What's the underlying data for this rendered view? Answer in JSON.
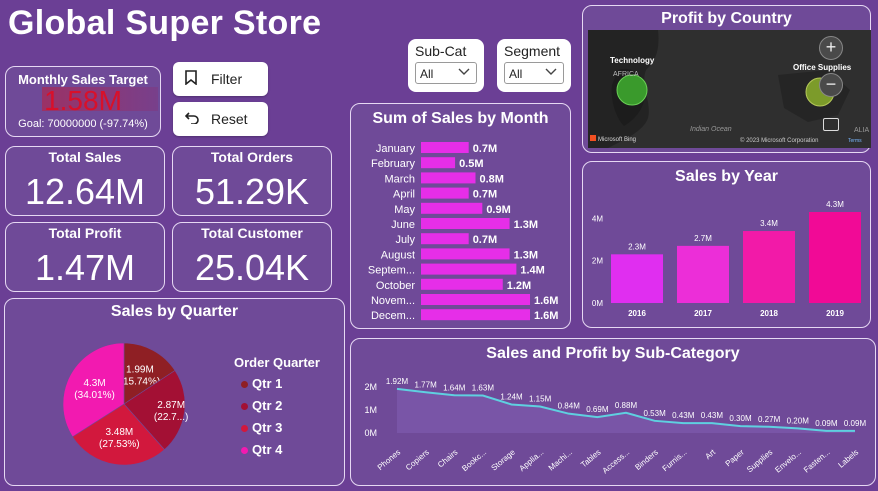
{
  "app": {
    "title": "Global Super Store"
  },
  "controls": {
    "filter_label": "Filter",
    "reset_label": "Reset",
    "subcat": {
      "label": "Sub-Cat",
      "value": "All"
    },
    "segment": {
      "label": "Segment",
      "value": "All"
    }
  },
  "target_card": {
    "title": "Monthly Sales Target",
    "value": "1.58M",
    "goal": "Goal: 70000000 (-97.74%)",
    "value_color": "#d8102a"
  },
  "kpis": {
    "total_sales": {
      "label": "Total Sales",
      "value": "12.64M"
    },
    "total_orders": {
      "label": "Total Orders",
      "value": "51.29K"
    },
    "total_profit": {
      "label": "Total Profit",
      "value": "1.47M"
    },
    "total_customer": {
      "label": "Total Customer",
      "value": "25.04K"
    }
  },
  "map_card": {
    "title": "Profit by Country",
    "labels": {
      "technology": "Technology",
      "office_supplies": "Office Supplies",
      "africa": "AFRICA",
      "ocean": "Indian Ocean",
      "australia": "ALIA"
    },
    "copyright": "© 2023 Microsoft Corporation",
    "terms": "Terms",
    "brand": "Microsoft Bing",
    "zoom_in": "+",
    "zoom_out": "−"
  },
  "chart_data": [
    {
      "type": "bar",
      "orientation": "horizontal",
      "title": "Sum of Sales by Month",
      "categories": [
        "January",
        "February",
        "March",
        "April",
        "May",
        "June",
        "July",
        "August",
        "Septem...",
        "October",
        "Novem...",
        "Decem..."
      ],
      "values": [
        0.7,
        0.5,
        0.8,
        0.7,
        0.9,
        1.3,
        0.7,
        1.3,
        1.4,
        1.2,
        1.6,
        1.6
      ],
      "labels": [
        "0.7M",
        "0.5M",
        "0.8M",
        "0.7M",
        "0.9M",
        "1.3M",
        "0.7M",
        "1.3M",
        "1.4M",
        "1.2M",
        "1.6M",
        "1.6M"
      ],
      "unit": "M",
      "color": "#e62ee8"
    },
    {
      "type": "bar",
      "title": "Sales by Year",
      "categories": [
        "2016",
        "2017",
        "2018",
        "2019"
      ],
      "values": [
        2.3,
        2.7,
        3.4,
        4.3
      ],
      "labels": [
        "2.3M",
        "2.7M",
        "3.4M",
        "4.3M"
      ],
      "yticks": [
        "0M",
        "2M",
        "4M"
      ],
      "ylim": [
        0,
        4.3
      ],
      "colors": [
        "#e02ef0",
        "#ec2ed8",
        "#f21aa8",
        "#f10a96"
      ]
    },
    {
      "type": "pie",
      "title": "Sales by Quarter",
      "legend_title": "Order Quarter",
      "categories": [
        "Qtr 1",
        "Qtr 2",
        "Qtr 3",
        "Qtr 4"
      ],
      "values": [
        1.99,
        2.87,
        3.48,
        4.3
      ],
      "percents": [
        "15.74%",
        "22.7...",
        "27.53%",
        "34.01%"
      ],
      "value_labels": [
        "1.99M",
        "2.87M",
        "3.48M",
        "4.3M"
      ],
      "colors": [
        "#8f1f24",
        "#a31034",
        "#d2183d",
        "#f21ab0"
      ]
    },
    {
      "type": "area",
      "title": "Sales and Profit by Sub-Category",
      "categories": [
        "Phones",
        "Copiers",
        "Chairs",
        "Bookc...",
        "Storage",
        "Applia...",
        "Machi...",
        "Tables",
        "Access...",
        "Binders",
        "Furnis...",
        "Art",
        "Paper",
        "Supplies",
        "Envelo...",
        "Fasten...",
        "Labels"
      ],
      "values": [
        1.92,
        1.77,
        1.64,
        1.63,
        1.24,
        1.15,
        0.84,
        0.69,
        0.88,
        0.53,
        0.43,
        0.43,
        0.3,
        0.27,
        0.2,
        0.09,
        0.09
      ],
      "labels": [
        "1.92M",
        "1.77M",
        "1.64M",
        "1.63M",
        "1.24M",
        "1.15M",
        "0.84M",
        "0.69M",
        "0.88M",
        "0.53M",
        "0.43M",
        "0.43M",
        "0.30M",
        "0.27M",
        "0.20M",
        "0.09M",
        "0.09M"
      ],
      "yticks": [
        "0M",
        "1M",
        "2M"
      ],
      "ylim": [
        0,
        2
      ],
      "line_color": "#5fd0e0"
    }
  ]
}
